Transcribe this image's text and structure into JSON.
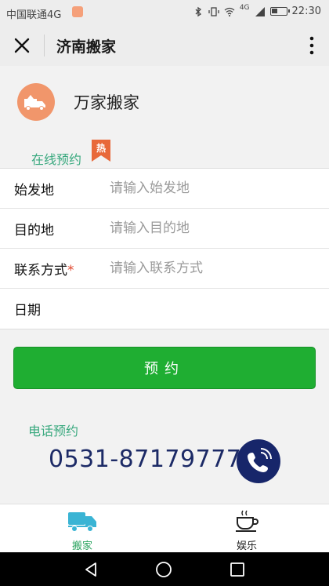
{
  "statusbar": {
    "carrier": "中国联通4G",
    "network": "4G",
    "time": "22:30"
  },
  "navbar": {
    "title": "济南搬家"
  },
  "brand": {
    "name": "万家搬家",
    "logo_color": "#f1966b"
  },
  "online": {
    "label": "在线预约",
    "hot_badge": "热"
  },
  "form": {
    "rows": [
      {
        "label": "始发地",
        "placeholder": "请输入始发地",
        "required": false
      },
      {
        "label": "目的地",
        "placeholder": "请输入目的地",
        "required": false
      },
      {
        "label": "联系方式",
        "placeholder": "请输入联系方式",
        "required": true,
        "required_mark": "*"
      },
      {
        "label": "日期",
        "placeholder": "",
        "required": false
      }
    ],
    "submit_label": "预约"
  },
  "phone": {
    "label": "电话预约",
    "number": "0531-87179777"
  },
  "tabbar": {
    "tabs": [
      {
        "label": "搬家",
        "icon": "truck-icon",
        "active": true
      },
      {
        "label": "娱乐",
        "icon": "coffee-cup-icon",
        "active": false
      }
    ]
  },
  "colors": {
    "accent_green": "#1fae32",
    "label_teal": "#3aa97f",
    "phone_navy": "#1c2a66",
    "required_red": "#e0462d",
    "hot_orange": "#e8693a"
  }
}
